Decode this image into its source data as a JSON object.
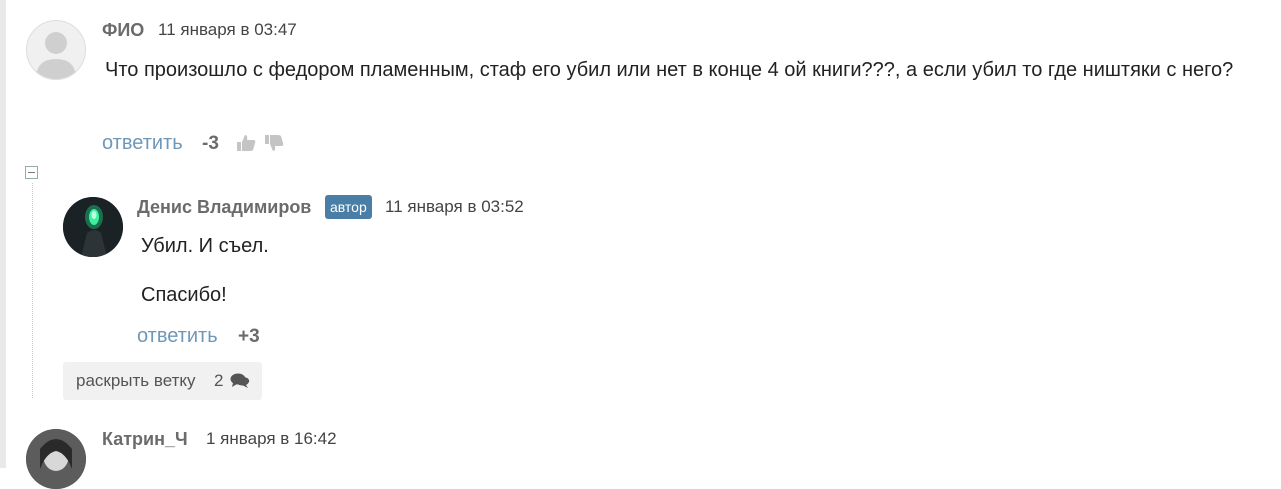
{
  "comments": [
    {
      "author": "ФИО",
      "time": "11 января в 03:47",
      "text": "Что произошло с федором пламенным, стаф его убил или нет в конце 4 ой книги???, а если убил то где ништяки с него?",
      "reply_label": "ответить",
      "score": "-3"
    },
    {
      "author": "Денис Владимиров",
      "badge": "автор",
      "time": "11 января в 03:52",
      "paragraphs": [
        "Убил. И съел.",
        "Спасибо!"
      ],
      "reply_label": "ответить",
      "score": "+3"
    },
    {
      "author": "Катрин_Ч",
      "time": "1 января в 16:42"
    }
  ],
  "thread": {
    "expand_label": "раскрыть ветку",
    "expand_count": "2"
  },
  "icons": {
    "upvote": "thumbs-up-icon",
    "downvote": "thumbs-down-icon",
    "collapse": "minus-square-icon",
    "comments": "comments-icon"
  },
  "colors": {
    "link": "#6f98b8",
    "badge": "#4a7ea6",
    "author": "#6b6b6b"
  }
}
